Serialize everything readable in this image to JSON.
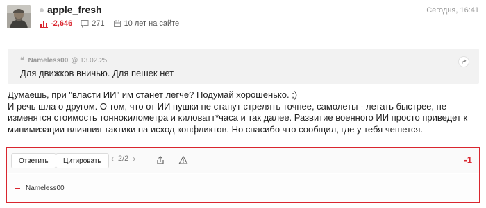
{
  "author": {
    "name": "apple_fresh",
    "online": false
  },
  "timestamp": "Сегодня, 16:41",
  "stats": {
    "rating": "-2,646",
    "comments": "271",
    "tenure": "10 лет на сайте"
  },
  "quote": {
    "author": "Nameless00",
    "date": "@ 13.02.25",
    "text": "Для движков вничью. Для пешек нет"
  },
  "body": {
    "paragraphs": [
      "Думаешь, при \"власти ИИ\" им станет легче? Подумай хорошенько. ;)",
      "И речь шла о другом. О том, что от ИИ пушки не станут стрелять точнее, самолеты - летать быстрее, не изменятся стоимость тоннокилометра и киловатт*часа и так далее. Развитие военного ИИ просто приведет к минимизации влияния тактики на исход конфликтов. Но спасибо что сообщил, где у тебя чешется."
    ]
  },
  "actions": {
    "reply_label": "Ответить",
    "quote_label": "Цитировать",
    "page_indicator": "2/2",
    "score": "-1"
  },
  "voters": [
    {
      "name": "Nameless00",
      "vote": "minus"
    }
  ],
  "colors": {
    "accent_red": "#d9262f",
    "quote_bg": "#f2f2f2",
    "muted_text": "#999999"
  }
}
